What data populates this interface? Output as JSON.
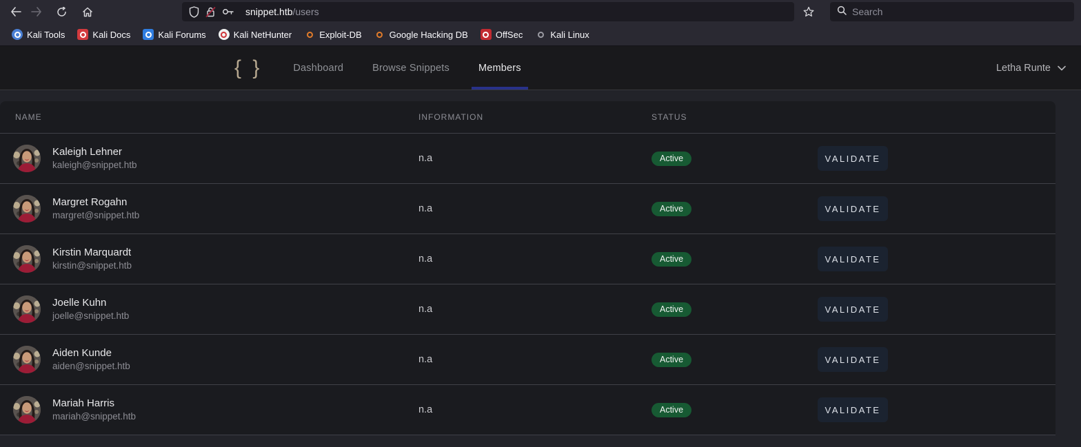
{
  "colors": {
    "accent": "#283189",
    "badge": "#175a33",
    "btn-bg": "#1b2330",
    "chrome-bg": "#2a2932",
    "field-bg": "#1c1b22",
    "page-bg": "#222329"
  },
  "browser": {
    "url_host": "snippet.htb",
    "url_path": "/users",
    "search_placeholder": "Search",
    "bookmarks": [
      {
        "label": "Kali Tools",
        "icon": "kali-tools-favicon",
        "bg": "#4a7fd4",
        "fg": "#ffffff",
        "radius": "50%"
      },
      {
        "label": "Kali Docs",
        "icon": "kali-docs-favicon",
        "bg": "#d23a3e",
        "fg": "#ffffff",
        "radius": "3px"
      },
      {
        "label": "Kali Forums",
        "icon": "kali-forums-favicon",
        "bg": "#2f7de1",
        "fg": "#ffffff",
        "radius": "3px"
      },
      {
        "label": "Kali NetHunter",
        "icon": "kali-nethunter-favicon",
        "bg": "#f2f2f2",
        "fg": "#d03438",
        "radius": "50%"
      },
      {
        "label": "Exploit-DB",
        "icon": "exploit-db-favicon",
        "bg": "transparent",
        "fg": "#e07b2a",
        "radius": "0"
      },
      {
        "label": "Google Hacking DB",
        "icon": "ghdb-favicon",
        "bg": "transparent",
        "fg": "#e07b2a",
        "radius": "0"
      },
      {
        "label": "OffSec",
        "icon": "offsec-favicon",
        "bg": "#c22a31",
        "fg": "#ffffff",
        "radius": "3px"
      },
      {
        "label": "Kali Linux",
        "icon": "kali-linux-favicon",
        "bg": "transparent",
        "fg": "#9a9aa2",
        "radius": "0"
      }
    ]
  },
  "app": {
    "logo_glyph": "{ }",
    "nav": [
      {
        "label": "Dashboard"
      },
      {
        "label": "Browse Snippets"
      },
      {
        "label": "Members"
      }
    ],
    "user_menu_label": "Letha Runte"
  },
  "table": {
    "columns": [
      "Name",
      "Information",
      "Status"
    ],
    "rows": [
      {
        "name": "Kaleigh Lehner",
        "email": "kaleigh@snippet.htb",
        "information": "n.a",
        "status": "Active",
        "action": "VALIDATE"
      },
      {
        "name": "Margret Rogahn",
        "email": "margret@snippet.htb",
        "information": "n.a",
        "status": "Active",
        "action": "VALIDATE"
      },
      {
        "name": "Kirstin Marquardt",
        "email": "kirstin@snippet.htb",
        "information": "n.a",
        "status": "Active",
        "action": "VALIDATE"
      },
      {
        "name": "Joelle Kuhn",
        "email": "joelle@snippet.htb",
        "information": "n.a",
        "status": "Active",
        "action": "VALIDATE"
      },
      {
        "name": "Aiden Kunde",
        "email": "aiden@snippet.htb",
        "information": "n.a",
        "status": "Active",
        "action": "VALIDATE"
      },
      {
        "name": "Mariah Harris",
        "email": "mariah@snippet.htb",
        "information": "n.a",
        "status": "Active",
        "action": "VALIDATE"
      }
    ]
  }
}
